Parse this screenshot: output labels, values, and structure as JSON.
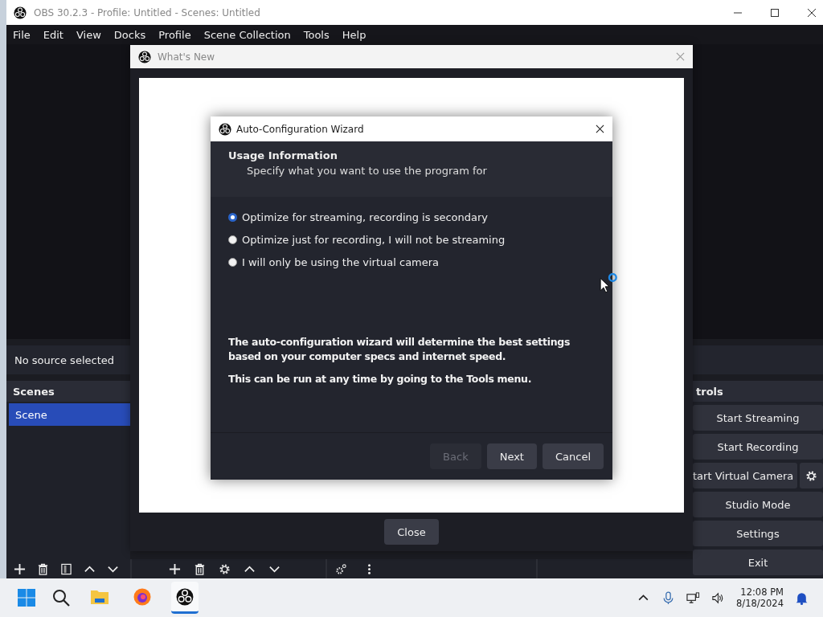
{
  "window": {
    "title": "OBS 30.2.3 - Profile: Untitled - Scenes: Untitled"
  },
  "menu": [
    "File",
    "Edit",
    "View",
    "Docks",
    "Profile",
    "Scene Collection",
    "Tools",
    "Help"
  ],
  "source_bar": {
    "text": "No source selected"
  },
  "scenes_dock": {
    "title": "Scenes",
    "items": [
      {
        "label": "Scene",
        "selected": true
      }
    ]
  },
  "controls_dock": {
    "title": "trols",
    "buttons": [
      {
        "label": "Start Streaming",
        "kind": "plain"
      },
      {
        "label": "Start Recording",
        "kind": "plain"
      },
      {
        "label": "tart Virtual Camera",
        "kind": "split"
      },
      {
        "label": "Studio Mode",
        "kind": "plain"
      },
      {
        "label": "Settings",
        "kind": "plain"
      },
      {
        "label": "Exit",
        "kind": "plain"
      }
    ]
  },
  "whats_new": {
    "title": "What's New",
    "close_button": "Close"
  },
  "wizard": {
    "title": "Auto-Configuration Wizard",
    "heading": "Usage Information",
    "subheading": "Specify what you want to use the program for",
    "options": [
      {
        "label": "Optimize for streaming, recording is secondary",
        "selected": true
      },
      {
        "label": "Optimize just for recording, I will not be streaming",
        "selected": false
      },
      {
        "label": "I will only be using the virtual camera",
        "selected": false
      }
    ],
    "notes": [
      "The auto-configuration wizard will determine the best settings based on your computer specs and internet speed.",
      "This can be run at any time by going to the Tools menu."
    ],
    "buttons": [
      {
        "label": "Back",
        "disabled": true
      },
      {
        "label": "Next",
        "disabled": false
      },
      {
        "label": "Cancel",
        "disabled": false
      }
    ]
  },
  "taskbar": {
    "apps": [
      {
        "kind": "folder",
        "selected": false
      },
      {
        "kind": "browser",
        "selected": false
      },
      {
        "kind": "obs",
        "selected": true
      }
    ]
  },
  "clock": {
    "time": "12:08 PM",
    "date": "8/18/2024"
  }
}
